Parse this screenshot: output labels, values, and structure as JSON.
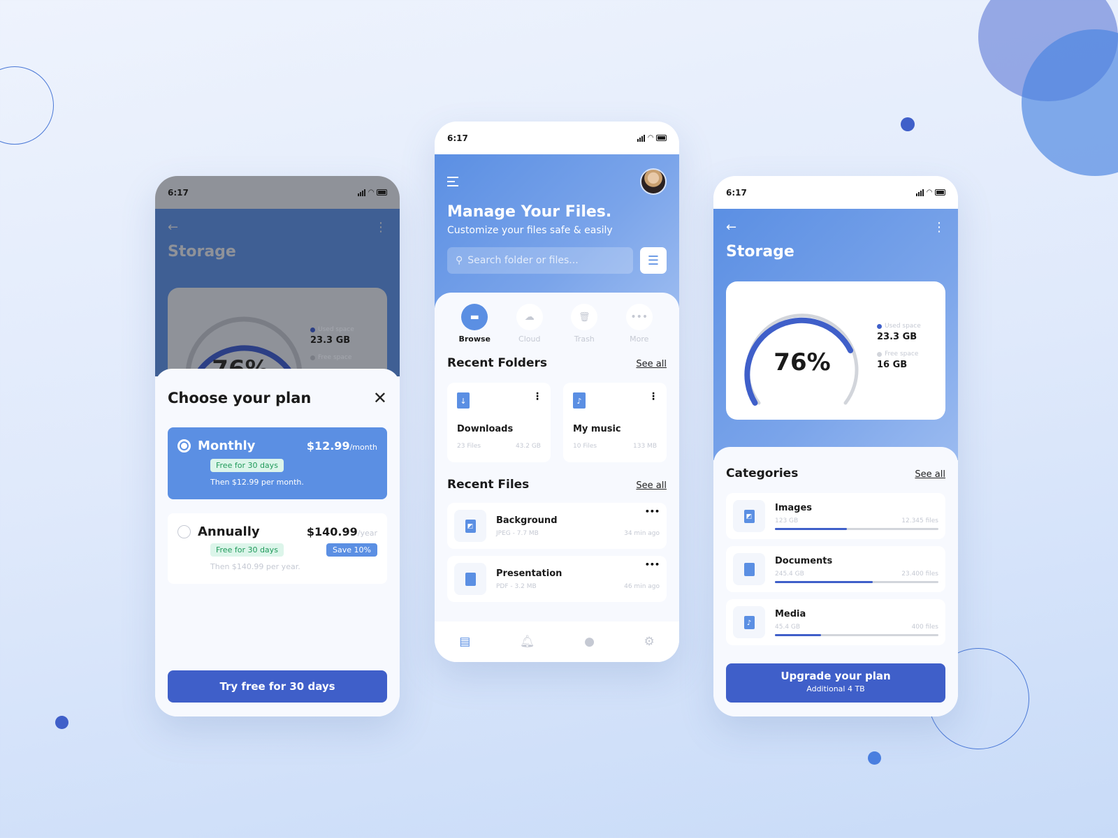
{
  "colors": {
    "primary": "#3f5fc9",
    "accent": "#5b8fe3",
    "green": "#1f9a5a",
    "muted": "#c5c9d3"
  },
  "status_time": "6:17",
  "left": {
    "title": "Storage",
    "gauge": {
      "percent": 0.76,
      "label": "76%"
    },
    "used_label": "Used space",
    "used_value": "23.3 GB",
    "free_label": "Free space",
    "sheet": {
      "title": "Choose your plan",
      "plans": [
        {
          "name": "Monthly",
          "price": "$12.99",
          "period": "/month",
          "tag": "Free for 30 days",
          "note": "Then $12.99 per month.",
          "selected": true
        },
        {
          "name": "Annually",
          "price": "$140.99",
          "period": "/year",
          "tag": "Free for 30 days",
          "badge": "Save 10%",
          "note": "Then $140.99 per year.",
          "selected": false
        }
      ],
      "cta": "Try free for 30 days"
    }
  },
  "middle": {
    "title": "Manage Your Files.",
    "subtitle": "Customize your files safe & easily",
    "search_placeholder": "Search folder or files...",
    "tabs": [
      {
        "label": "Browse",
        "icon": "folder-icon",
        "active": true
      },
      {
        "label": "Cloud",
        "icon": "cloud-icon",
        "active": false
      },
      {
        "label": "Trash",
        "icon": "trash-icon",
        "active": false
      },
      {
        "label": "More",
        "icon": "more-icon",
        "active": false
      }
    ],
    "recent_folders_title": "Recent Folders",
    "see_all": "See all",
    "folders": [
      {
        "name": "Downloads",
        "files": "23 Files",
        "size": "43.2 GB",
        "icon": "download-file-icon"
      },
      {
        "name": "My music",
        "files": "10 Files",
        "size": "133 MB",
        "icon": "music-file-icon"
      }
    ],
    "recent_files_title": "Recent Files",
    "files": [
      {
        "name": "Background",
        "type": "JPEG",
        "size": "7.7 MB",
        "time": "34 min ago",
        "icon": "image-file-icon"
      },
      {
        "name": "Presentation",
        "type": "PDF",
        "size": "3.2 MB",
        "time": "46 min ago",
        "icon": "document-icon"
      }
    ],
    "nav": [
      "files-icon",
      "bell-icon",
      "user-icon",
      "settings-icon"
    ]
  },
  "right": {
    "title": "Storage",
    "gauge": {
      "percent": 0.76,
      "label": "76%"
    },
    "used_label": "Used space",
    "used_value": "23.3 GB",
    "free_label": "Free space",
    "free_value": "16 GB",
    "categories_title": "Categories",
    "see_all": "See all",
    "categories": [
      {
        "name": "Images",
        "size": "123 GB",
        "count": "12.345 files",
        "progress": 0.44,
        "icon": "image-file-icon"
      },
      {
        "name": "Documents",
        "size": "245.4 GB",
        "count": "23.400 files",
        "progress": 0.6,
        "icon": "document-icon"
      },
      {
        "name": "Media",
        "size": "45.4 GB",
        "count": "400 files",
        "progress": 0.28,
        "icon": "music-file-icon"
      }
    ],
    "cta": "Upgrade your plan",
    "cta_sub": "Additional 4 TB"
  }
}
